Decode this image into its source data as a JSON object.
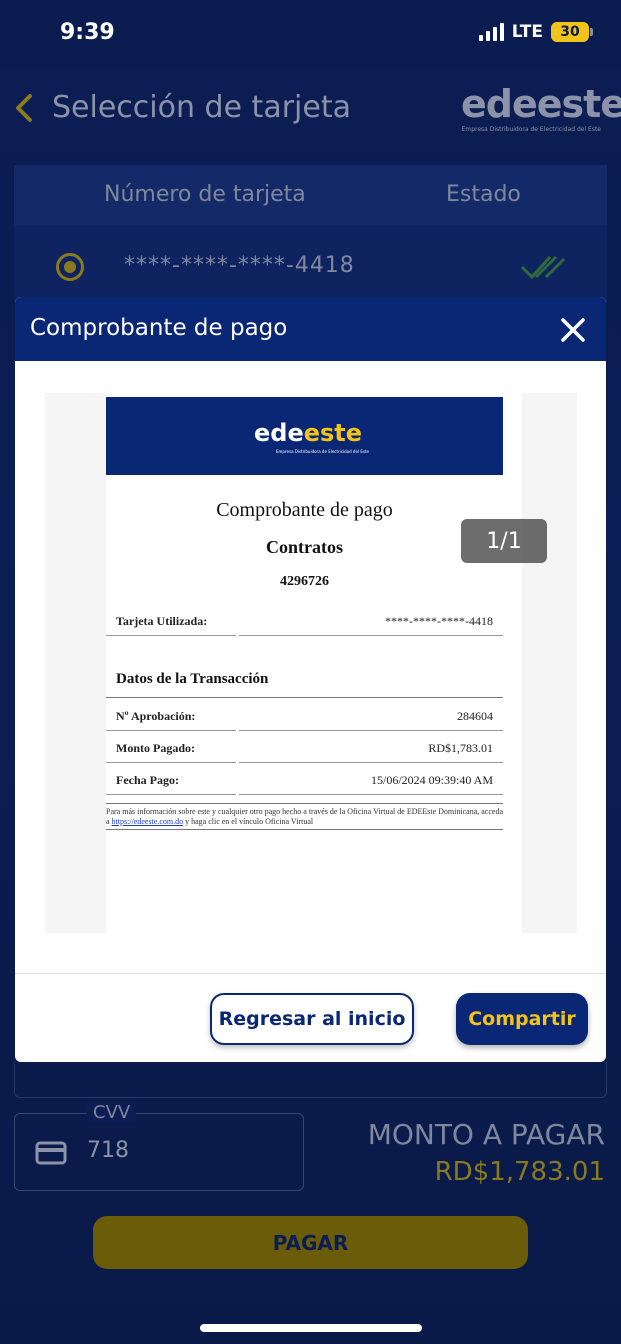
{
  "status_bar": {
    "time": "9:39",
    "network": "LTE",
    "battery": "30"
  },
  "header": {
    "title": "Selección de tarjeta",
    "brand": "edeeste",
    "brand_sub": "Empresa Distribuidora de Electricidad del Este"
  },
  "card_table": {
    "columns": [
      "Número de tarjeta",
      "Estado"
    ],
    "rows": [
      {
        "card_number": "****-****-****-4418",
        "state_icon": "double-check-icon"
      }
    ]
  },
  "modal": {
    "title": "Comprobante de pago",
    "page_counter": "1/1",
    "receipt": {
      "logo_white": "ede",
      "logo_yellow": "este",
      "logo_sub": "Empresa Distribuidora de Electricidad del Este",
      "title": "Comprobante de pago",
      "subtitle": "Contratos",
      "contract": "4296726",
      "card_label": "Tarjeta Utilizada:",
      "card_value": "****-****-****-4418",
      "section": "Datos de la Transacción",
      "rows": [
        {
          "label": "Nº Aprobación:",
          "value": "284604"
        },
        {
          "label": "Monto Pagado:",
          "value": "RD$1,783.01"
        },
        {
          "label": "Fecha Pago:",
          "value": "15/06/2024 09:39:40 AM"
        }
      ],
      "footer_pre": "Para más información sobre este y cualquier otro pago hecho a través de la Oficina Virtual de EDEEste Dominicana, acceda a ",
      "footer_link": "https://edeeste.com.do",
      "footer_post": " y haga clic en el vínculo Oficina Virtual"
    },
    "back_button": "Regresar al inicio",
    "share_button": "Compartir"
  },
  "payment": {
    "cvv_label": "CVV",
    "cvv_value": "718",
    "amount_label": "MONTO A PAGAR",
    "amount_value": "RD$1,783.01",
    "pay_button": "PAGAR"
  },
  "colors": {
    "navy": "#0a2775",
    "yellow": "#f2c318",
    "background": "#0a1a4a"
  }
}
